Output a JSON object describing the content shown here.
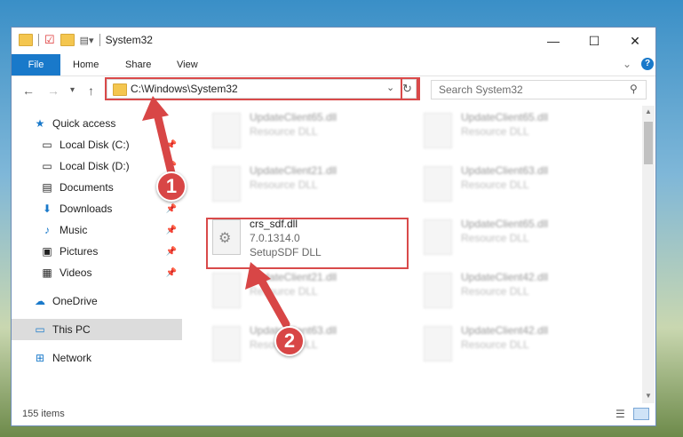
{
  "window": {
    "title": "System32"
  },
  "controls": {
    "minimize": "—",
    "maximize": "☐",
    "close": "✕"
  },
  "ribbon": {
    "tabs": [
      "File",
      "Home",
      "Share",
      "View"
    ],
    "expand": "⌄",
    "help": "?"
  },
  "address": {
    "path": "C:\\Windows\\System32"
  },
  "search": {
    "placeholder": "Search System32"
  },
  "sidebar": {
    "quick_access": "Quick access",
    "items": [
      {
        "label": "Local Disk (C:)",
        "icon": "drive-icon"
      },
      {
        "label": "Local Disk (D:)",
        "icon": "drive-icon"
      },
      {
        "label": "Documents",
        "icon": "documents-icon"
      },
      {
        "label": "Downloads",
        "icon": "downloads-icon"
      },
      {
        "label": "Music",
        "icon": "music-icon"
      },
      {
        "label": "Pictures",
        "icon": "pictures-icon"
      },
      {
        "label": "Videos",
        "icon": "videos-icon"
      }
    ],
    "onedrive": "OneDrive",
    "this_pc": "This PC",
    "network": "Network"
  },
  "files": {
    "left": [
      {
        "name": "UpdateClient65.dll",
        "type": "Resource DLL"
      },
      {
        "name": "UpdateClient21.dll",
        "type": "Resource DLL"
      },
      {
        "name": "crs_sdf.dll",
        "version": "7.0.1314.0",
        "desc": "SetupSDF DLL"
      },
      {
        "name": "UpdateClient21.dll",
        "type": "Resource DLL"
      },
      {
        "name": "UpdateClient63.dll",
        "type": "Resource DLL"
      }
    ],
    "right": [
      {
        "name": "UpdateClient65.dll",
        "type": "Resource DLL"
      },
      {
        "name": "UpdateClient63.dll",
        "type": "Resource DLL"
      },
      {
        "name": "UpdateClient65.dll",
        "type": "Resource DLL"
      },
      {
        "name": "UpdateClient42.dll",
        "type": "Resource DLL"
      },
      {
        "name": "UpdateClient42.dll",
        "type": "Resource DLL"
      }
    ]
  },
  "status": {
    "count": "155 items"
  },
  "annotations": {
    "step1": "1",
    "step2": "2"
  }
}
